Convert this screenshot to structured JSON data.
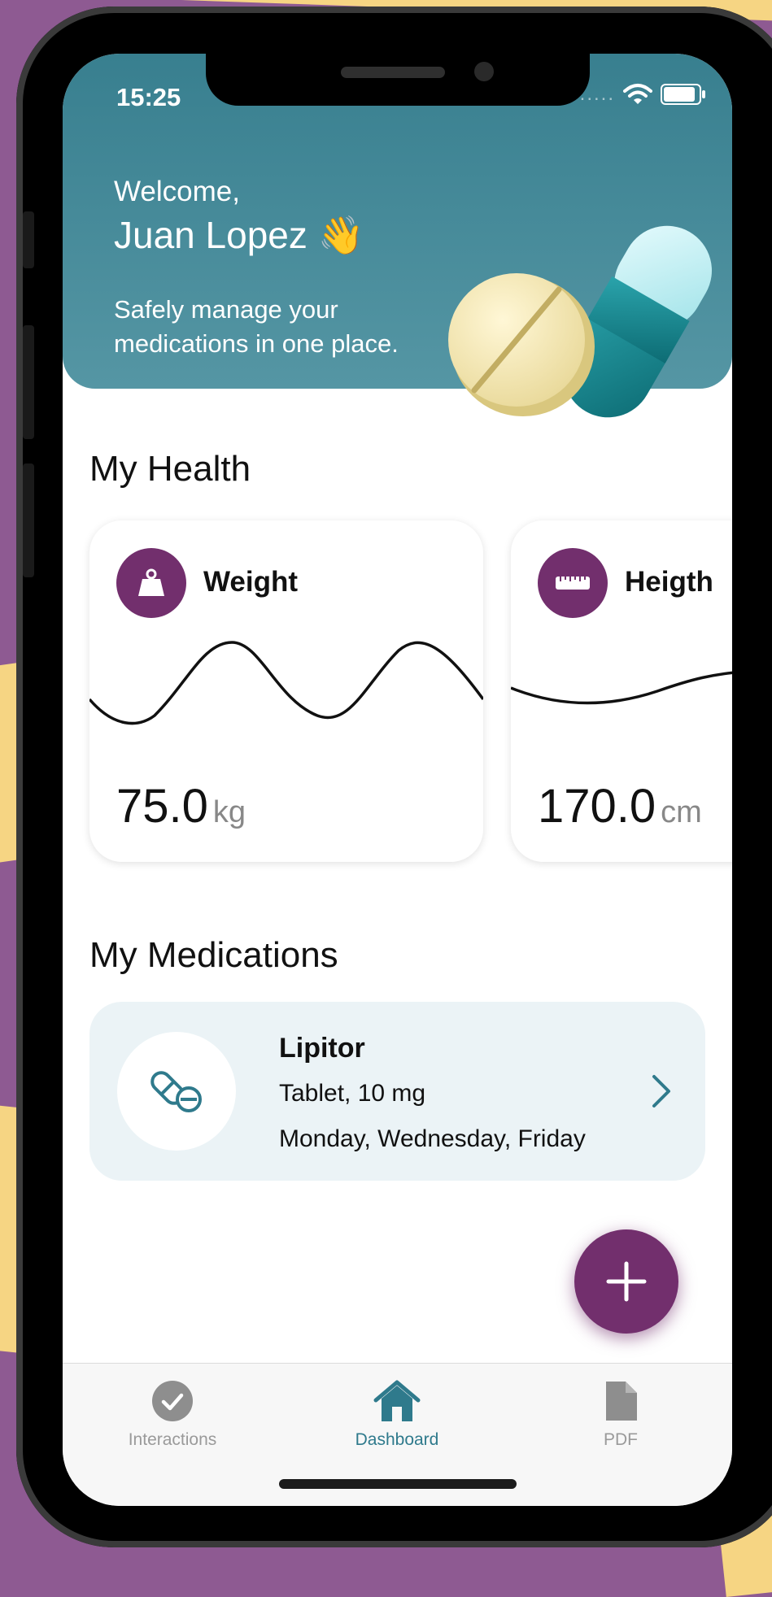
{
  "status_bar": {
    "time": "15:25",
    "signal": "....."
  },
  "header": {
    "greeting": "Welcome,",
    "user_name": "Juan Lopez 👋",
    "tagline_line1": "Safely manage your",
    "tagline_line2": "medications in one place."
  },
  "health": {
    "title": "My Health",
    "cards": [
      {
        "label": "Weight",
        "value": "75.0",
        "unit": "kg",
        "icon": "weight-icon"
      },
      {
        "label": "Heigth",
        "value": "170.0",
        "unit": "cm",
        "icon": "ruler-icon"
      }
    ]
  },
  "medications": {
    "title": "My Medications",
    "items": [
      {
        "name": "Lipitor",
        "dose": "Tablet, 10 mg",
        "days": "Monday, Wednesday, Friday",
        "icon": "pills-icon"
      }
    ]
  },
  "tabs": [
    {
      "label": "Interactions",
      "icon": "check-circle-icon",
      "active": false
    },
    {
      "label": "Dashboard",
      "icon": "home-icon",
      "active": true
    },
    {
      "label": "PDF",
      "icon": "document-icon",
      "active": false
    }
  ],
  "colors": {
    "accent": "#722f6d",
    "primary": "#2f7a8c",
    "header_start": "#387f8f",
    "header_end": "#5596a4",
    "background": "#8e5a92",
    "decor": "#f6d583"
  }
}
